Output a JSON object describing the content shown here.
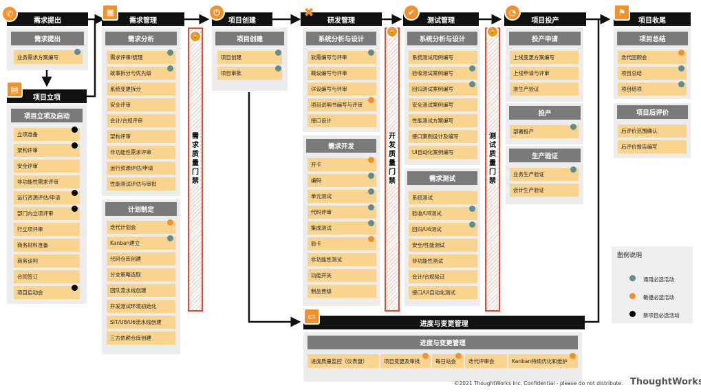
{
  "phases": {
    "p1": {
      "title": "需求提出",
      "sub": "需求提出",
      "items": [
        "业务需求方案编写"
      ]
    },
    "p1b": {
      "title": "项目立项",
      "sub": "项目立项及启动",
      "items": [
        "立项准备",
        "架构评审",
        "安全评审",
        "非功能性需求评审",
        "运行资源评估/申请",
        "部门内立项评审",
        "行立项评审",
        "商务材料准备",
        "商务谈判",
        "合同签订",
        "项目启动会"
      ]
    },
    "p2": {
      "title": "需求管理",
      "sub1": "需求分析",
      "items1": [
        "需求评审/梳理",
        "故事拆分与优先级",
        "系统变更拆分",
        "安全评审",
        "会计/合规评审",
        "架构评审",
        "非功能性需求评审",
        "运行资源评估/申请",
        "性能测试评估与审批"
      ],
      "sub2": "计划制定",
      "items2": [
        "迭代计划会",
        "Kanban建立",
        "代码仓库创建",
        "分支策略选取",
        "团队流水线创建",
        "开发测试环境初始化",
        "SIT/U8/U6流水线创建",
        "三方依赖仓库创建"
      ]
    },
    "p3": {
      "title": "项目创建",
      "sub": "项目创建",
      "items": [
        "项目创建",
        "项目审批"
      ]
    },
    "p4": {
      "title": "研发管理",
      "sub1": "系统分析与设计",
      "items1": [
        "软需编写与评审",
        "概设编写与评审",
        "详设编写与评审",
        "项目说明书编写与评审",
        "接口设计"
      ],
      "sub2": "需求开发",
      "items2": [
        "开卡",
        "编码",
        "单元测试",
        "代码评审",
        "集成测试",
        "验卡",
        "非功能性测试",
        "功能开关",
        "制品晋级"
      ]
    },
    "p5": {
      "title": "测试管理",
      "sub1": "系统分析与设计",
      "items1": [
        "系统测试用例编写",
        "验收测试案例编写",
        "回归测试案例编写",
        "安全测试案例编写",
        "性能测试方案编写",
        "接口案例设计及编写",
        "UI自动化案例编写"
      ],
      "sub2": "需求测试",
      "items2": [
        "系统测试",
        "验收/U8测试",
        "回归/U6测试",
        "安全/性能测试",
        "非功能性测试",
        "会计/合规验证",
        "接口/UI自动化测试"
      ]
    },
    "p6": {
      "title": "项目投产",
      "sub1": "投产申请",
      "items1": [
        "上线变更方案编写",
        "上线申请与评审",
        "准生产验证"
      ],
      "sub2": "投产",
      "items2": [
        "部署投产"
      ],
      "sub3": "生产验证",
      "items3": [
        "业务生产验证",
        "会计生产验证"
      ]
    },
    "p7": {
      "title": "项目收尾",
      "sub1": "项目总结",
      "items1": [
        "迭代回顾会",
        "项目总结",
        "项目结项"
      ],
      "sub2": "项目后评价",
      "items2": [
        "后评价范围确认",
        "后评价报告编写"
      ]
    },
    "p8": {
      "title": "进度与变更管理",
      "sub": "进度与变更管理",
      "items": [
        "进度质量监控（仪表盘）",
        "项目变更及审批",
        "每日站会",
        "迭代评审会",
        "Kanban持续优化和维护"
      ]
    }
  },
  "gates": {
    "g1": "需求质量门禁",
    "g2": "开发质量门禁",
    "g3": "测试质量门禁"
  },
  "legend": {
    "title": "图例说明",
    "items": [
      "通用必选活动",
      "敏捷必选活动",
      "新项目必选活动"
    ]
  },
  "colors": {
    "generic": "#5f8c8c",
    "agile": "#f0922b",
    "new_project": "#000000",
    "gate": "#e14b33",
    "item": "#f9d48e"
  },
  "footer": "©2021 ThoughtWorks Inc.  Confidential - please do not distribute.",
  "brand": "ThoughtWorks"
}
